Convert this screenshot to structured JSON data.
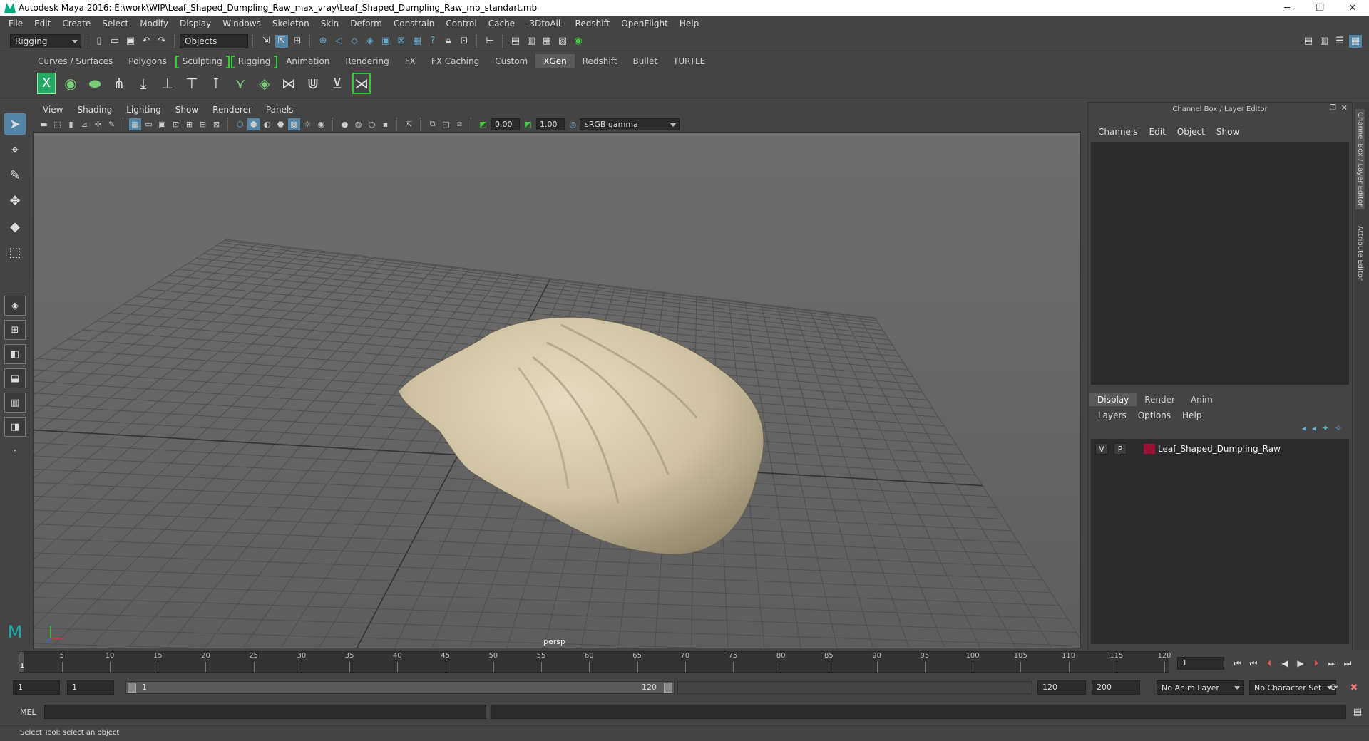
{
  "window": {
    "title": "Autodesk Maya 2016: E:\\work\\WIP\\Leaf_Shaped_Dumpling_Raw_max_vray\\Leaf_Shaped_Dumpling_Raw_mb_standart.mb",
    "minimize": "─",
    "restore": "❐",
    "close": "✕"
  },
  "menu": [
    "File",
    "Edit",
    "Create",
    "Select",
    "Modify",
    "Display",
    "Windows",
    "Skeleton",
    "Skin",
    "Deform",
    "Constrain",
    "Control",
    "Cache",
    "-3DtoAll-",
    "Redshift",
    "OpenFlight",
    "Help"
  ],
  "status_line": {
    "menu_set": "Rigging",
    "selection_mode": "Objects"
  },
  "shelf": {
    "tabs": [
      {
        "label": "Curves / Surfaces",
        "active": false,
        "bracketed": false
      },
      {
        "label": "Polygons",
        "active": false,
        "bracketed": false
      },
      {
        "label": "Sculpting",
        "active": false,
        "bracketed": true
      },
      {
        "label": "Rigging",
        "active": false,
        "bracketed": true
      },
      {
        "label": "Animation",
        "active": false,
        "bracketed": false
      },
      {
        "label": "Rendering",
        "active": false,
        "bracketed": false
      },
      {
        "label": "FX",
        "active": false,
        "bracketed": false
      },
      {
        "label": "FX Caching",
        "active": false,
        "bracketed": false
      },
      {
        "label": "Custom",
        "active": false,
        "bracketed": false
      },
      {
        "label": "XGen",
        "active": true,
        "bracketed": false
      },
      {
        "label": "Redshift",
        "active": false,
        "bracketed": false
      },
      {
        "label": "Bullet",
        "active": false,
        "bracketed": false
      },
      {
        "label": "TURTLE",
        "active": false,
        "bracketed": false
      }
    ],
    "tools": [
      "xgen-icon",
      "xgen-preview-icon",
      "xgen-collection-icon",
      "xgen-add-guides-icon",
      "xgen-guide-tool-icon",
      "xgen-place-guide-icon",
      "xgen-sculpt-guide-icon",
      "xgen-lock-guide-icon",
      "xgen-groom-icon",
      "xgen-layer-icon",
      "xgen-cut-icon",
      "xgen-comb-icon",
      "xgen-clump-icon",
      "xgen-select-icon"
    ]
  },
  "panel": {
    "menu": [
      "View",
      "Shading",
      "Lighting",
      "Show",
      "Renderer",
      "Panels"
    ],
    "exposure": "0.00",
    "gamma": "1.00",
    "color_space": "sRGB gamma",
    "camera": "persp"
  },
  "channel_box": {
    "header": "Channel Box / Layer Editor",
    "menu": [
      "Channels",
      "Edit",
      "Object",
      "Show"
    ]
  },
  "layer_editor": {
    "tabs": [
      {
        "label": "Display",
        "active": true
      },
      {
        "label": "Render",
        "active": false
      },
      {
        "label": "Anim",
        "active": false
      }
    ],
    "menu": [
      "Layers",
      "Options",
      "Help"
    ],
    "layers": [
      {
        "visible": "V",
        "playback": "P",
        "name": "Leaf_Shaped_Dumpling_Raw",
        "color": "#9b1236"
      }
    ]
  },
  "side_tabs": [
    "Channel Box / Layer Editor",
    "Attribute Editor"
  ],
  "timeline": {
    "ticks": [
      "1",
      "5",
      "10",
      "15",
      "20",
      "25",
      "30",
      "35",
      "40",
      "45",
      "50",
      "55",
      "60",
      "65",
      "70",
      "75",
      "80",
      "85",
      "90",
      "95",
      "100",
      "105",
      "110",
      "115",
      "120"
    ],
    "current_frame": "1"
  },
  "range": {
    "start": "1",
    "playback_start": "1",
    "range_start_label": "1",
    "range_end_label": "120",
    "playback_end": "120",
    "end": "200",
    "anim_layer": "No Anim Layer",
    "character_set": "No Character Set"
  },
  "command_line": {
    "label": "MEL"
  },
  "help_line": {
    "text": "Select Tool: select an object"
  },
  "colors": {
    "accent": "#5285a6",
    "shelf_green": "#33cc33",
    "layer_swatch": "#9b1236"
  }
}
